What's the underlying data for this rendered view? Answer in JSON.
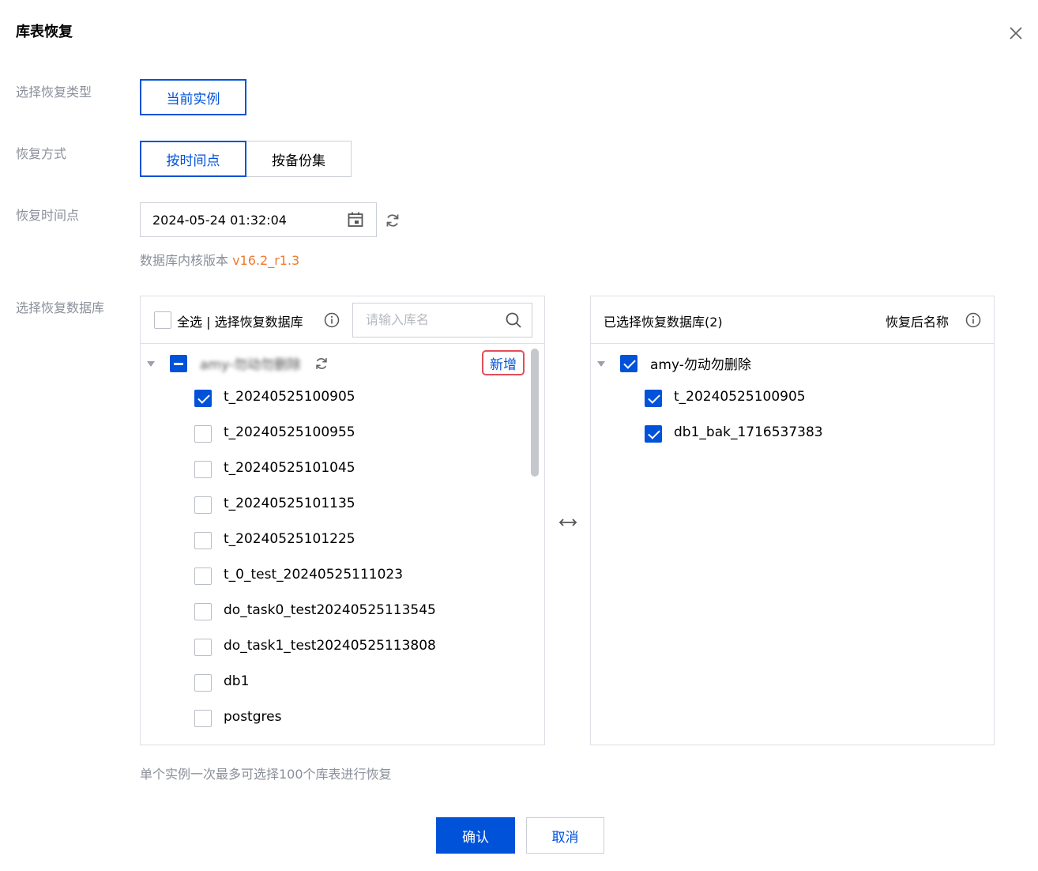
{
  "dialog": {
    "title": "库表恢复"
  },
  "form": {
    "restore_type_label": "选择恢复类型",
    "restore_type_option": "当前实例",
    "restore_method_label": "恢复方式",
    "restore_method_options": [
      "按时间点",
      "按备份集"
    ],
    "restore_time_label": "恢复时间点",
    "restore_time_value": "2024-05-24 01:32:04",
    "kernel_version_prefix": "数据库内核版本",
    "kernel_version": "v16.2_r1.3",
    "select_db_label": "选择恢复数据库"
  },
  "left_panel": {
    "select_all_label": "全选 | 选择恢复数据库",
    "search_placeholder": "请输入库名",
    "root_name": "amy-勿动勿删除",
    "add_button": "新增",
    "items": [
      {
        "name": "t_20240525100905",
        "checked": true
      },
      {
        "name": "t_20240525100955",
        "checked": false
      },
      {
        "name": "t_20240525101045",
        "checked": false
      },
      {
        "name": "t_20240525101135",
        "checked": false
      },
      {
        "name": "t_20240525101225",
        "checked": false
      },
      {
        "name": "t_0_test_20240525111023",
        "checked": false
      },
      {
        "name": "do_task0_test20240525113545",
        "checked": false
      },
      {
        "name": "do_task1_test20240525113808",
        "checked": false
      },
      {
        "name": "db1",
        "checked": false
      },
      {
        "name": "postgres",
        "checked": false
      }
    ]
  },
  "right_panel": {
    "title": "已选择恢复数据库(2)",
    "rename_label": "恢复后名称",
    "root_name": "amy-勿动勿删除",
    "items": [
      {
        "name": "t_20240525100905"
      },
      {
        "name": "db1_bak_1716537383"
      }
    ]
  },
  "hint": "单个实例一次最多可选择100个库表进行恢复",
  "footer": {
    "confirm": "确认",
    "cancel": "取消"
  },
  "colors": {
    "primary": "#0052d9",
    "version": "#ed7b2f",
    "highlight_border": "#e34d59"
  }
}
